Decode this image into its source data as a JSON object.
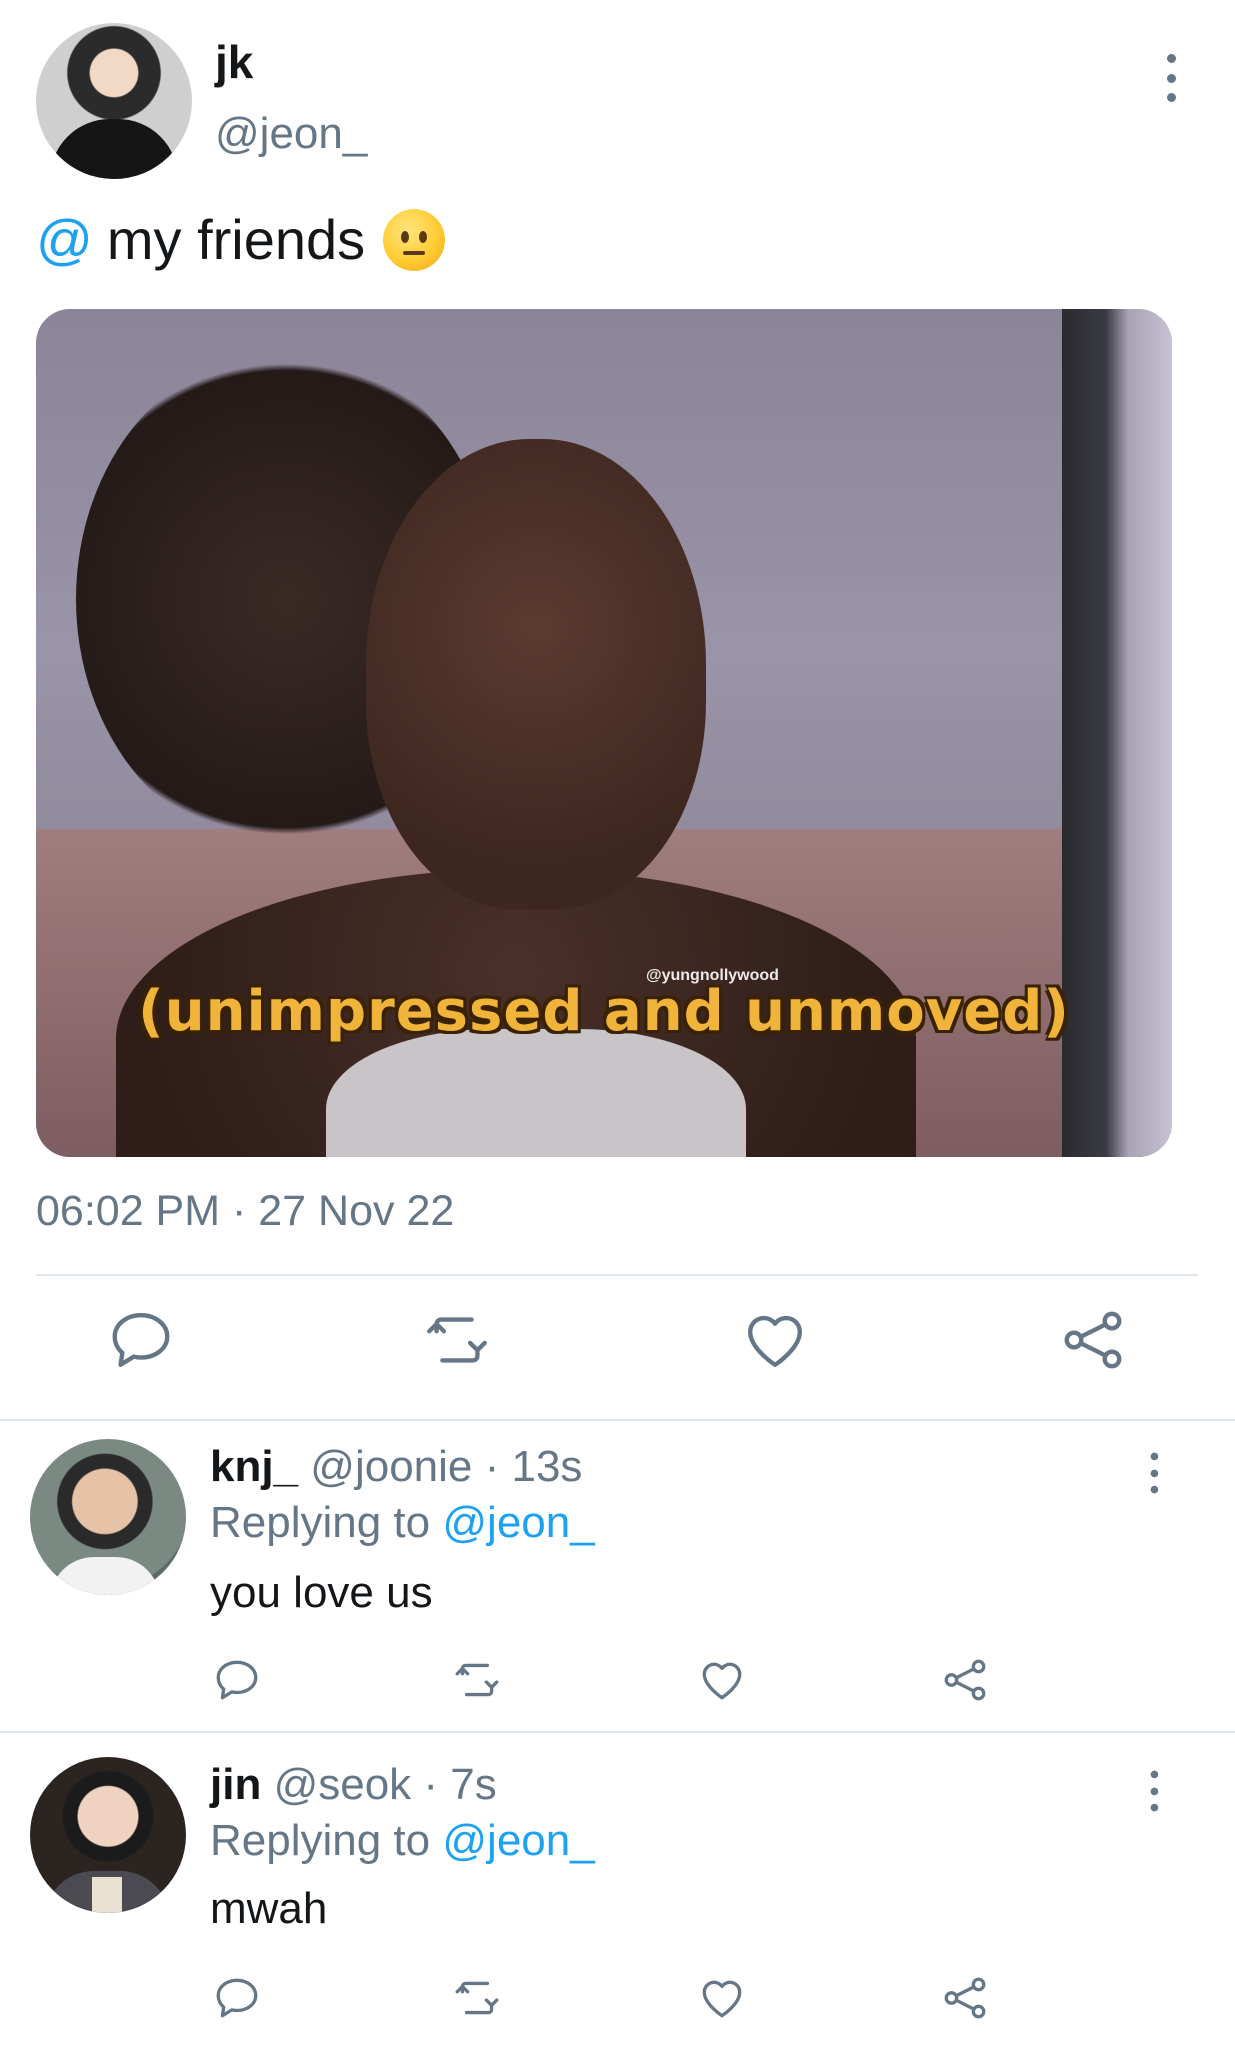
{
  "tweet": {
    "author_name": "jk",
    "author_handle": "@jeon_",
    "text_mention": "@",
    "text_body": "my friends",
    "emoji": "neutral-face-emoji",
    "media": {
      "caption": "(unimpressed and unmoved)",
      "watermark": "@yungnollywood"
    },
    "timestamp": "06:02 PM · 27 Nov 22",
    "actions": [
      "reply",
      "retweet",
      "like",
      "share"
    ]
  },
  "replies": [
    {
      "name": "knj_",
      "meta_rest": "@joonie · 13s",
      "replying_prefix": "Replying to",
      "replying_mention": "@jeon_",
      "text": "you love us"
    },
    {
      "name": "jin",
      "meta_rest": "@seok · 7s",
      "replying_prefix": "Replying to",
      "replying_mention": "@jeon_",
      "text": "mwah"
    }
  ],
  "colors": {
    "accent": "#1da1f2",
    "secondary_text": "#657786",
    "primary_text": "#14171a",
    "divider": "#e1e8ed",
    "caption": "#f0b43a"
  }
}
